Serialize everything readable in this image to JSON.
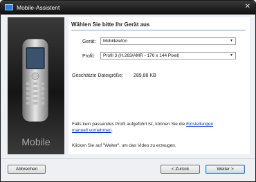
{
  "window": {
    "title": "Mobile-Assistent",
    "close_glyph": "✕"
  },
  "sidebar": {
    "label": "Mobile",
    "image_icon": "mobile-phone-illustration"
  },
  "main": {
    "heading": "Wählen Sie bitte Ihr Gerät aus",
    "device": {
      "label": "Gerät:",
      "value": "Mobiltelefon"
    },
    "profile": {
      "label": "Profil:",
      "value": "Profil 3 (H.263/AMR - 176 x 144 Pixel)"
    },
    "filesize": {
      "label": "Geschätzte Dateigröße:",
      "value": "289,88 KB"
    },
    "info_text": "Falls kein passendes Profil aufgeführt ist, können Sie die ",
    "info_link": "Einstellungen manuell vornehmen",
    "info_end": ".",
    "instruction": "Klicken Sie auf \"Weiter\", um das Video zu erzeugen."
  },
  "footer": {
    "cancel": "Abbrechen",
    "back": "< Zurück",
    "next": "Weiter >"
  },
  "colors": {
    "link": "#0033cc",
    "sidebar_dark": "#151515"
  }
}
